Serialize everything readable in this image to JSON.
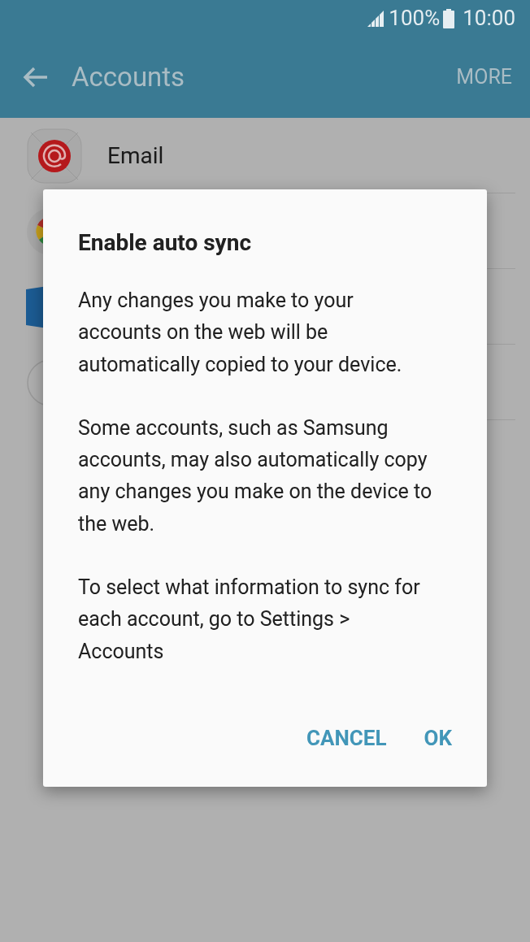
{
  "status_bar": {
    "battery": "100%",
    "time": "10:00"
  },
  "app_bar": {
    "title": "Accounts",
    "action": "MORE"
  },
  "accounts": [
    {
      "kind": "email",
      "label": "Email"
    },
    {
      "kind": "google"
    },
    {
      "kind": "exchange"
    },
    {
      "kind": "add"
    }
  ],
  "dialog": {
    "title": "Enable auto sync",
    "paragraphs": [
      "Any changes you make to your accounts on the web will be automatically copied to your device.",
      "Some accounts, such as Samsung accounts, may also automatically copy any changes you make on the device to the web.",
      "To select what information to sync for each account, go to Settings > Accounts"
    ],
    "buttons": [
      "CANCEL",
      "OK"
    ]
  }
}
